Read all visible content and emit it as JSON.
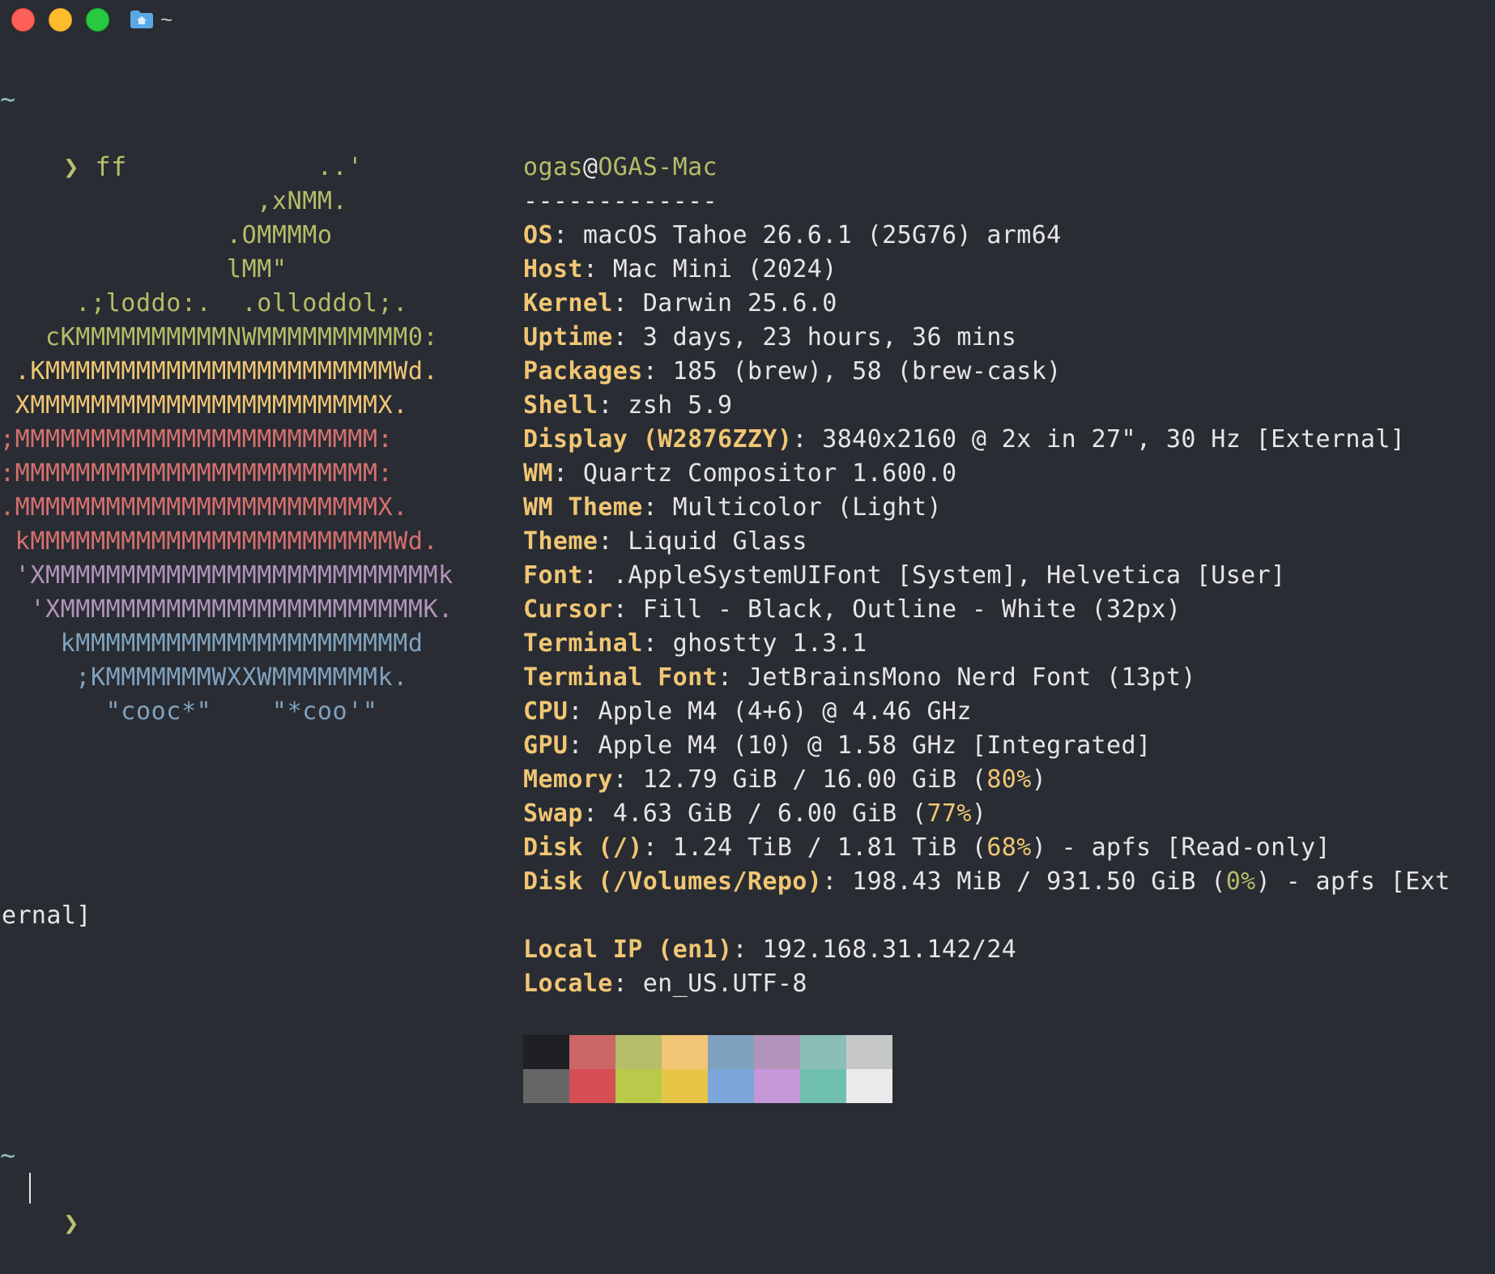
{
  "window": {
    "tab_title": "~",
    "folder_icon": "folder-home-icon"
  },
  "prompt1": {
    "cwd": "~",
    "arrow": "❯",
    "command": "ff"
  },
  "ascii_logo": [
    {
      "text": "                     ..'",
      "color": "green"
    },
    {
      "text": "                 ,xNMM.",
      "color": "green"
    },
    {
      "text": "               .OMMMMo",
      "color": "green"
    },
    {
      "text": "               lMM\"",
      "color": "green"
    },
    {
      "text": "     .;loddo:.  .olloddol;.",
      "color": "green"
    },
    {
      "text": "   cKMMMMMMMMMMNWMMMMMMMMMM0:",
      "color": "green"
    },
    {
      "text": " .KMMMMMMMMMMMMMMMMMMMMMMMWd.",
      "color": "yellow"
    },
    {
      "text": " XMMMMMMMMMMMMMMMMMMMMMMMX.",
      "color": "yellow"
    },
    {
      "text": ";MMMMMMMMMMMMMMMMMMMMMMMM:",
      "color": "red"
    },
    {
      "text": ":MMMMMMMMMMMMMMMMMMMMMMMM:",
      "color": "red"
    },
    {
      "text": ".MMMMMMMMMMMMMMMMMMMMMMMMX.",
      "color": "red"
    },
    {
      "text": " kMMMMMMMMMMMMMMMMMMMMMMMMWd.",
      "color": "red"
    },
    {
      "text": " 'XMMMMMMMMMMMMMMMMMMMMMMMMMMk",
      "color": "purple"
    },
    {
      "text": "  'XMMMMMMMMMMMMMMMMMMMMMMMMK.",
      "color": "purple"
    },
    {
      "text": "    kMMMMMMMMMMMMMMMMMMMMMMd",
      "color": "blue"
    },
    {
      "text": "     ;KMMMMMMMWXXWMMMMMMMk.",
      "color": "blue"
    },
    {
      "text": "       \"cooc*\"    \"*coo'\"",
      "color": "blue"
    }
  ],
  "info": {
    "user": "ogas",
    "at": "@",
    "host": "OGAS-Mac",
    "separator": "-------------",
    "rows": [
      {
        "key": "OS",
        "value": "macOS Tahoe 26.6.1 (25G76) arm64"
      },
      {
        "key": "Host",
        "value": "Mac Mini (2024)"
      },
      {
        "key": "Kernel",
        "value": "Darwin 25.6.0"
      },
      {
        "key": "Uptime",
        "value": "3 days, 23 hours, 36 mins"
      },
      {
        "key": "Packages",
        "value": "185 (brew), 58 (brew-cask)"
      },
      {
        "key": "Shell",
        "value": "zsh 5.9"
      },
      {
        "key": "Display (W2876ZZY)",
        "value": "3840x2160 @ 2x in 27\", 30 Hz [External]"
      },
      {
        "key": "WM",
        "value": "Quartz Compositor 1.600.0"
      },
      {
        "key": "WM Theme",
        "value": "Multicolor (Light)"
      },
      {
        "key": "Theme",
        "value": "Liquid Glass"
      },
      {
        "key": "Font",
        "value": ".AppleSystemUIFont [System], Helvetica [User]"
      },
      {
        "key": "Cursor",
        "value": "Fill - Black, Outline - White (32px)"
      },
      {
        "key": "Terminal",
        "value": "ghostty 1.3.1"
      },
      {
        "key": "Terminal Font",
        "value": "JetBrainsMono Nerd Font (13pt)"
      },
      {
        "key": "CPU",
        "value": "Apple M4 (4+6) @ 4.46 GHz"
      },
      {
        "key": "GPU",
        "value": "Apple M4 (10) @ 1.58 GHz [Integrated]"
      }
    ],
    "memory": {
      "key": "Memory",
      "pre": "12.79 GiB / 16.00 GiB (",
      "pct": "80%",
      "post": ")"
    },
    "swap": {
      "key": "Swap",
      "pre": "4.63 GiB / 6.00 GiB (",
      "pct": "77%",
      "post": ")"
    },
    "disk1": {
      "key": "Disk (/)",
      "pre": "1.24 TiB / 1.81 TiB (",
      "pct": "68%",
      "post": ") - apfs [Read-only]"
    },
    "disk2": {
      "key": "Disk (/Volumes/Repo)",
      "pre": "198.43 MiB / 931.50 GiB (",
      "pct": "0%",
      "post": ") - apfs [Ext"
    },
    "disk2_wrap": "ernal]",
    "local_ip": {
      "key": "Local IP (en1)",
      "value": "192.168.31.142/24"
    },
    "locale": {
      "key": "Locale",
      "value": "en_US.UTF-8"
    }
  },
  "palette": {
    "top": [
      "#1e2024",
      "#cc6666",
      "#b5bd68",
      "#f0c674",
      "#81a2be",
      "#b294bb",
      "#8abeb7",
      "#c5c8c6"
    ],
    "bottom": [
      "#666666",
      "#d54e53",
      "#b9ca4a",
      "#e7c547",
      "#7aa6da",
      "#c397d8",
      "#70c0b1",
      "#eaeaea"
    ]
  },
  "prompt2": {
    "cwd": "~",
    "arrow": "❯"
  }
}
